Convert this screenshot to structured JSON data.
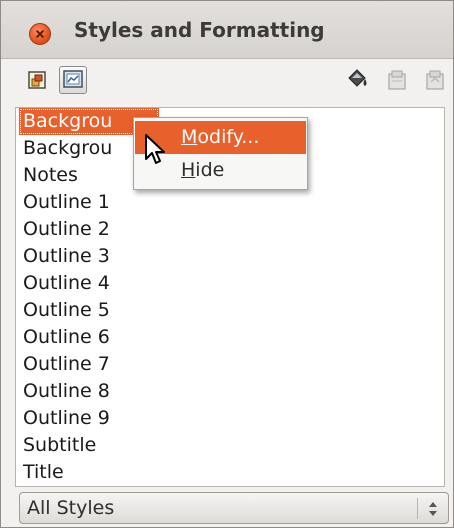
{
  "window": {
    "title": "Styles and Formatting"
  },
  "toolbar": {
    "buttons": [
      {
        "name": "graphic-styles",
        "icon": "graphic-styles-icon"
      },
      {
        "name": "presentation-styles",
        "icon": "presentation-styles-icon",
        "active": true
      },
      {
        "name": "fill-format-mode",
        "icon": "paint-bucket-icon"
      },
      {
        "name": "new-style-from-selection",
        "icon": "new-style-icon"
      },
      {
        "name": "update-style",
        "icon": "update-style-icon"
      }
    ]
  },
  "styles_list": {
    "items": [
      {
        "label": "Backgrou",
        "selected": true
      },
      {
        "label": "Backgrou"
      },
      {
        "label": "Notes"
      },
      {
        "label": "Outline 1"
      },
      {
        "label": "Outline 2"
      },
      {
        "label": "Outline 3"
      },
      {
        "label": "Outline 4"
      },
      {
        "label": "Outline 5"
      },
      {
        "label": "Outline 6"
      },
      {
        "label": "Outline 7"
      },
      {
        "label": "Outline 8"
      },
      {
        "label": "Outline 9"
      },
      {
        "label": "Subtitle"
      },
      {
        "label": "Title"
      }
    ]
  },
  "context_menu": {
    "modify": {
      "mnemonic": "M",
      "rest": "odify..."
    },
    "hide": {
      "mnemonic": "H",
      "rest": "ide"
    }
  },
  "filter": {
    "selected": "All Styles"
  },
  "colors": {
    "highlight": "#e8602c",
    "close_button": "#e6541b"
  }
}
